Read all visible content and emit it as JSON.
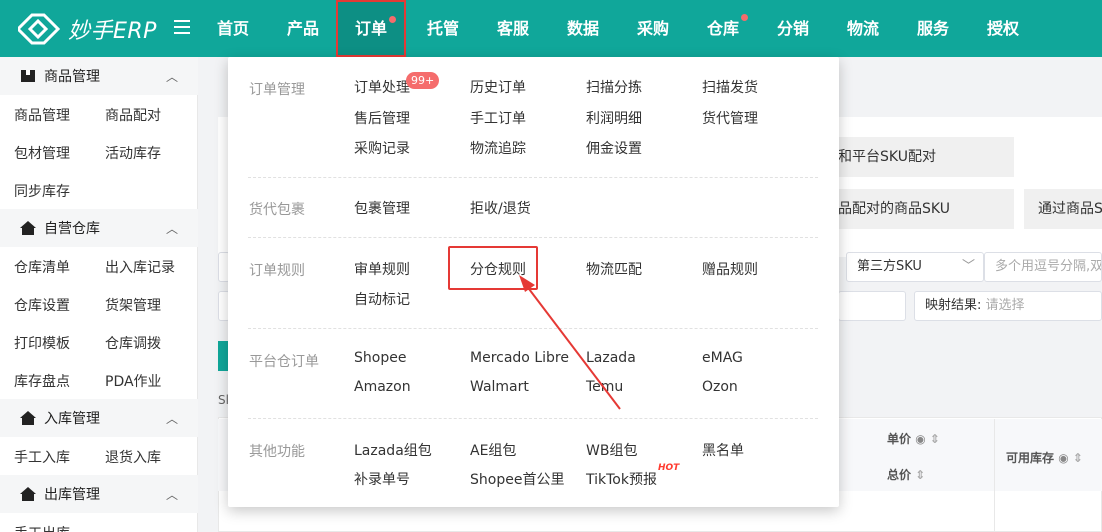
{
  "app": {
    "logo_text": "妙手ERP",
    "nav": [
      {
        "label": "首页"
      },
      {
        "label": "产品"
      },
      {
        "label": "订单"
      },
      {
        "label": "托管"
      },
      {
        "label": "客服"
      },
      {
        "label": "数据"
      },
      {
        "label": "采购"
      },
      {
        "label": "仓库"
      },
      {
        "label": "分销"
      },
      {
        "label": "物流"
      },
      {
        "label": "服务"
      },
      {
        "label": "授权"
      }
    ]
  },
  "sidebar": {
    "groups": [
      {
        "label": "商品管理",
        "items": [
          "商品管理",
          "商品配对",
          "包材管理",
          "活动库存",
          "同步库存"
        ]
      },
      {
        "label": "自营仓库",
        "items": [
          "仓库清单",
          "出入库记录",
          "仓库设置",
          "货架管理",
          "打印模板",
          "仓库调拨",
          "库存盘点",
          "PDA作业"
        ]
      },
      {
        "label": "入库管理",
        "items": [
          "手工入库",
          "退货入库"
        ]
      },
      {
        "label": "出库管理",
        "items": [
          "手工出库"
        ]
      }
    ]
  },
  "background": {
    "step1": "和平台SKU配对",
    "step2": "品配对的商品SKU",
    "step3": "通过商品S",
    "select_value": "第三方SKU",
    "multi_input_placeholder": "多个用逗号分隔,双",
    "mapping_label": "映射结果:",
    "mapping_placeholder": "请选择",
    "col_price": "单价",
    "col_total": "总价",
    "col_stock": "可用库存",
    "small_text": "Sl"
  },
  "dropdown": {
    "sections": [
      {
        "title": "订单管理",
        "items": [
          "订单处理",
          "历史订单",
          "扫描分拣",
          "扫描发货",
          "售后管理",
          "手工订单",
          "利润明细",
          "货代管理",
          "采购记录",
          "物流追踪",
          "佣金设置"
        ],
        "badge": "99+"
      },
      {
        "title": "货代包裹",
        "items": [
          "包裹管理",
          "拒收/退货"
        ]
      },
      {
        "title": "订单规则",
        "items": [
          "审单规则",
          "分仓规则",
          "物流匹配",
          "赠品规则",
          "自动标记"
        ]
      },
      {
        "title": "平台仓订单",
        "items": [
          "Shopee",
          "Mercado Libre",
          "Lazada",
          "eMAG",
          "Amazon",
          "Walmart",
          "Temu",
          "Ozon"
        ]
      },
      {
        "title": "其他功能",
        "items": [
          "Lazada组包",
          "AE组包",
          "WB组包",
          "黑名单",
          "补录单号",
          "Shopee首公里",
          "TikTok预报"
        ],
        "hot": "HOT"
      }
    ]
  },
  "colors": {
    "topbar": "#10a79a",
    "highlight": "#e53935",
    "badge": "#f56c6c"
  }
}
